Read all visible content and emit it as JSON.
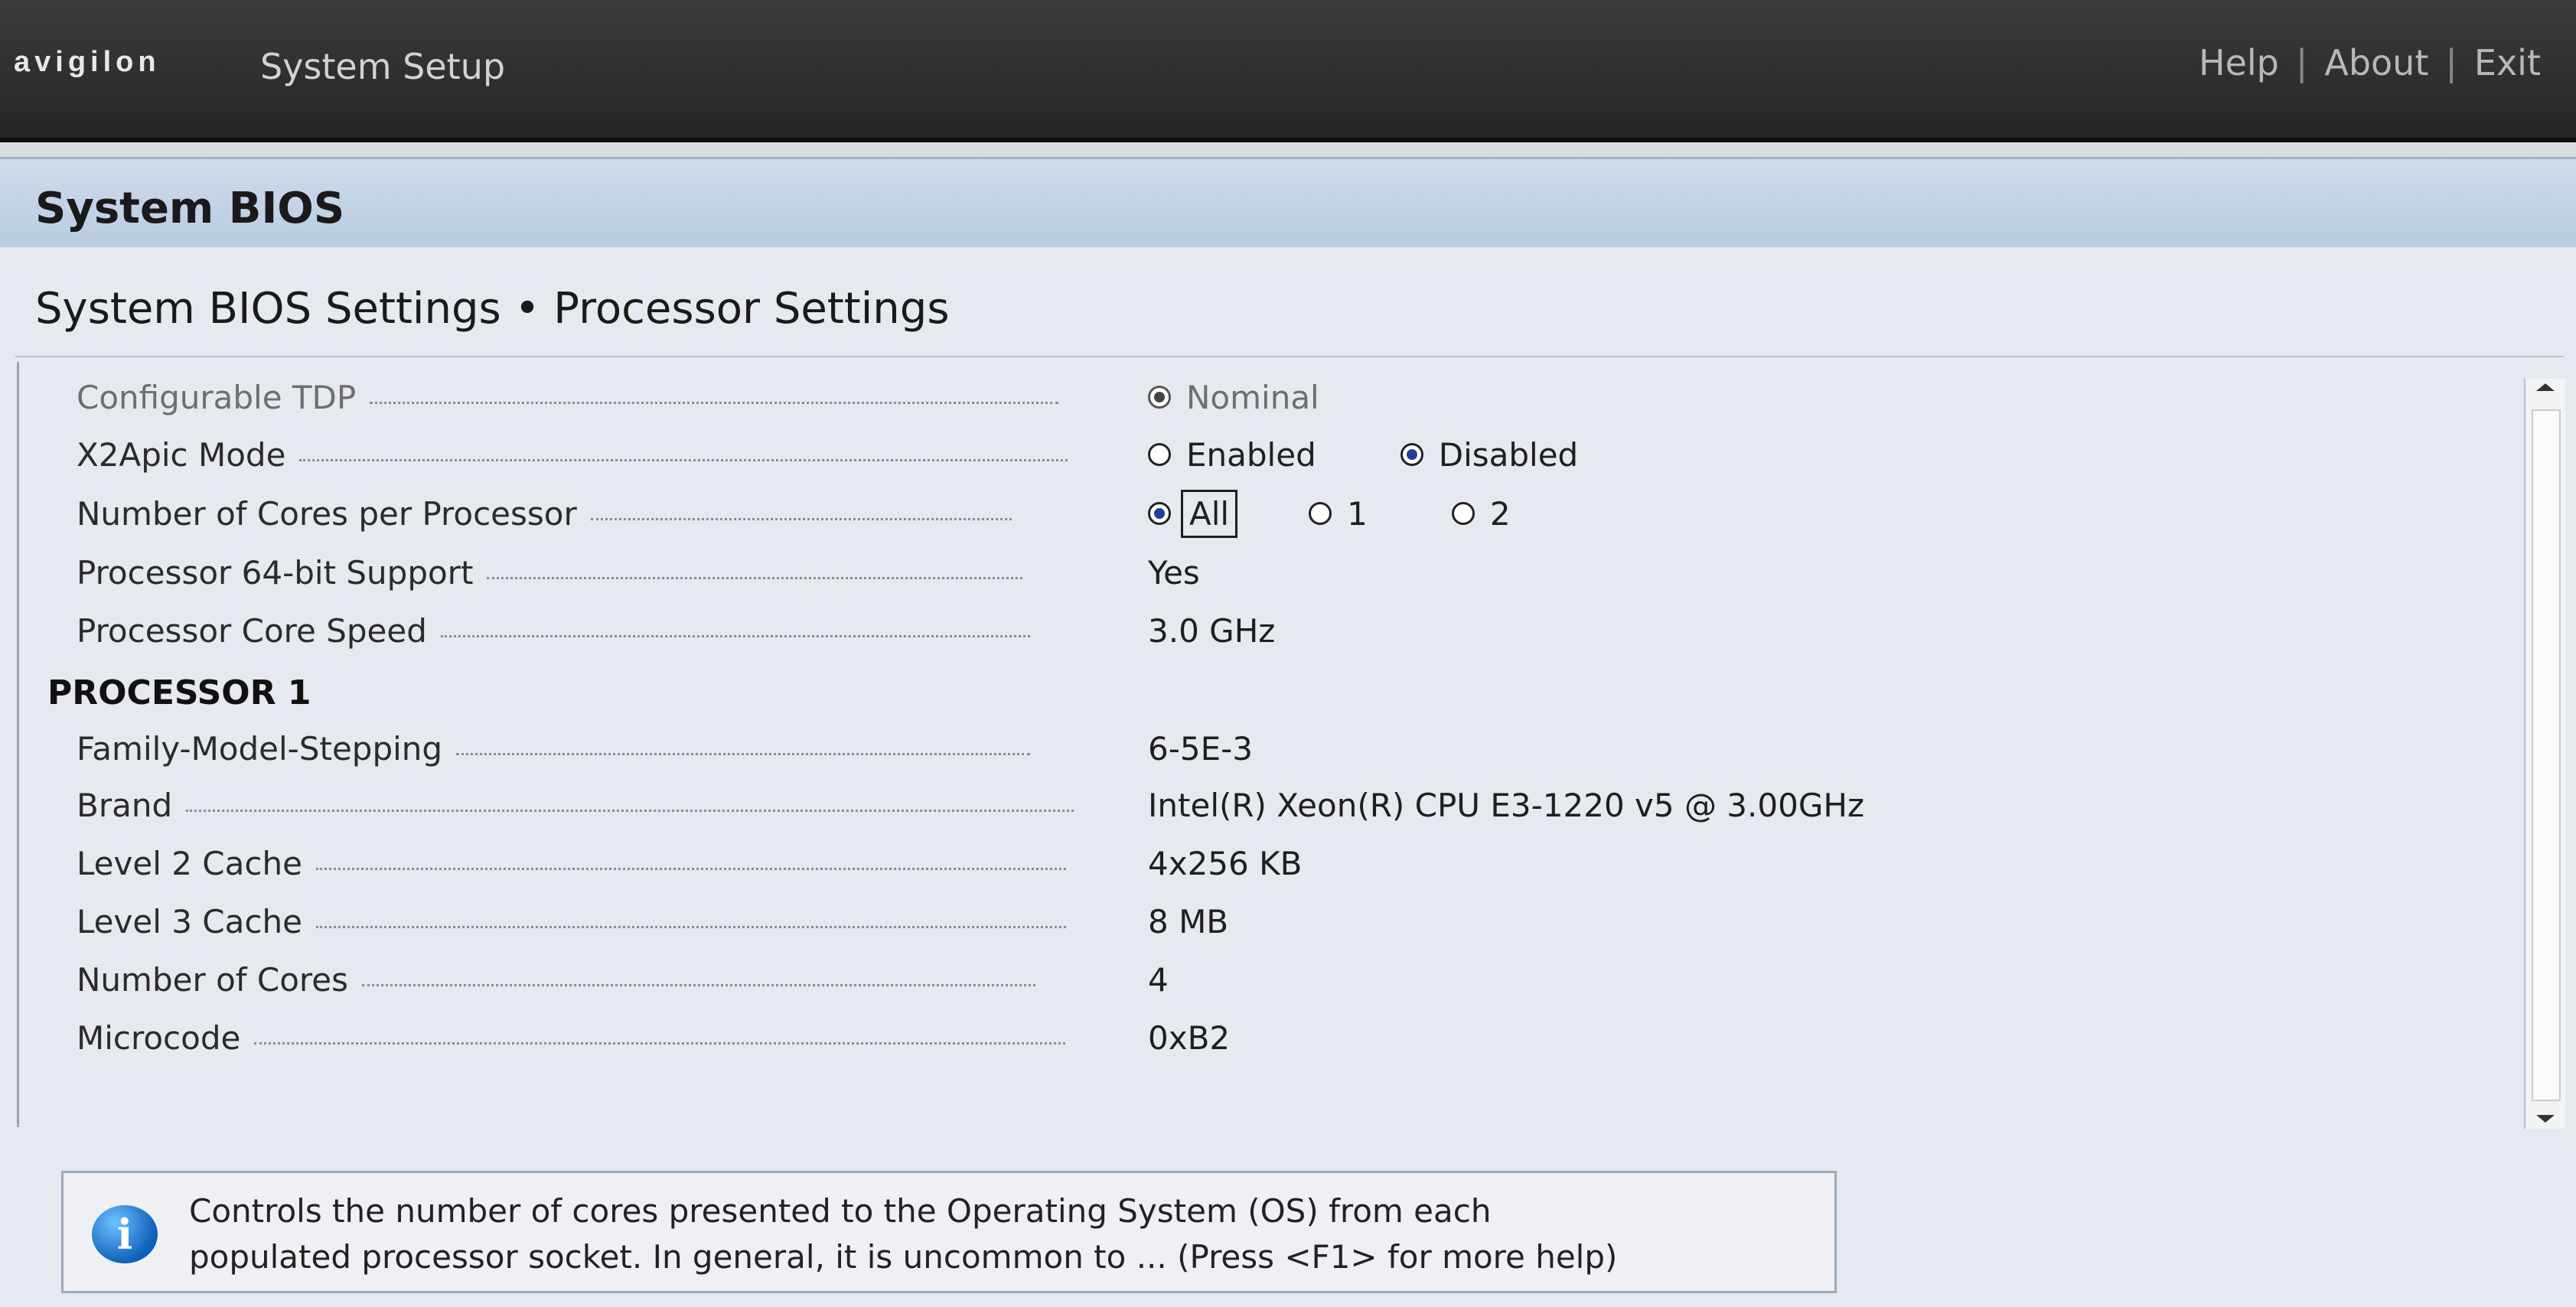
{
  "header": {
    "logo_text": "avigilon",
    "app_title": "System Setup",
    "links": [
      "Help",
      "About",
      "Exit"
    ]
  },
  "panel": {
    "title": "System BIOS",
    "page_title": "System BIOS Settings • Processor Settings"
  },
  "settings": [
    {
      "label": "Configurable TDP",
      "disabled": true,
      "options": [
        {
          "label": "Nominal",
          "selected": true
        }
      ]
    },
    {
      "label": "X2Apic Mode",
      "options": [
        {
          "label": "Enabled",
          "selected": false
        },
        {
          "label": "Disabled",
          "selected": true
        }
      ]
    },
    {
      "label": "Number of Cores per Processor",
      "options": [
        {
          "label": "All",
          "selected": true,
          "focused": true
        },
        {
          "label": "1",
          "selected": false
        },
        {
          "label": "2",
          "selected": false
        }
      ]
    },
    {
      "label": "Processor 64-bit Support",
      "value": "Yes"
    },
    {
      "label": "Processor Core Speed",
      "value": "3.0 GHz"
    }
  ],
  "processor_section": {
    "title": "PROCESSOR 1",
    "rows": [
      {
        "label": "Family-Model-Stepping",
        "value": "6-5E-3"
      },
      {
        "label": "Brand",
        "value": "Intel(R) Xeon(R) CPU E3-1220 v5 @ 3.00GHz"
      },
      {
        "label": "Level 2 Cache",
        "value": "4x256 KB"
      },
      {
        "label": "Level 3 Cache",
        "value": "8 MB"
      },
      {
        "label": "Number of Cores",
        "value": "4"
      },
      {
        "label": "Microcode",
        "value": "0xB2"
      }
    ]
  },
  "help": {
    "icon": "info-icon",
    "text_line1": "Controls the number of cores presented to the Operating System (OS) from each",
    "text_line2": "populated processor socket. In general, it is uncommon to ... (Press <F1> for more help)"
  },
  "colors": {
    "topbar": "#2b2c2e",
    "panel_header": "#b7cbe0",
    "content_bg": "#e6e9ef",
    "radio_selected": "#1f3f9a",
    "info_icon": "#0d5fb8"
  }
}
